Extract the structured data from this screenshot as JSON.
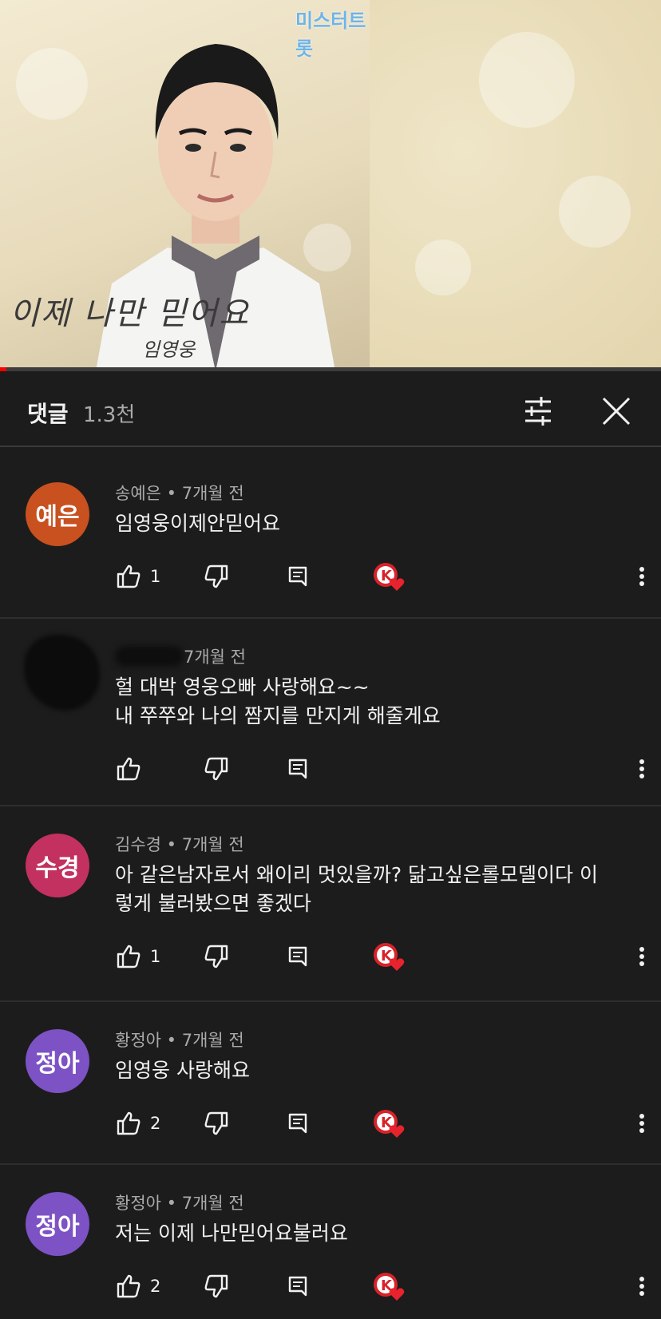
{
  "video": {
    "song_title": "이제 나만 믿어요",
    "artist": "임영웅",
    "logo_text": "미스터트롯"
  },
  "header": {
    "title": "댓글",
    "count": "1.3천"
  },
  "icons": {
    "filter": "sliders-icon",
    "close": "close-icon",
    "like": "thumb-up-icon",
    "dislike": "thumb-down-icon",
    "reply": "reply-icon",
    "creator_heart": "creator-heart-badge-icon",
    "more": "more-vert-icon"
  },
  "colors": {
    "background": "#1c1c1c",
    "avatar_1": "#c9501f",
    "avatar_2": "#c2315f",
    "avatar_3": "#7d52c4",
    "heart": "#e8232e"
  },
  "comments": [
    {
      "avatar_text": "예은",
      "author": "송예은",
      "time": "7개월 전",
      "lines": [
        "임영웅이제안믿어요"
      ],
      "likes": "1",
      "hearted": true
    },
    {
      "avatar_text": "",
      "author": "",
      "time": "7개월 전",
      "lines": [
        "헐 대박 영웅오빠 사랑해요~~",
        "내 쭈쭈와 나의 짬지를 만지게 해줄게요"
      ],
      "likes": "",
      "hearted": false
    },
    {
      "avatar_text": "수경",
      "author": "김수경",
      "time": "7개월 전",
      "lines": [
        "아 같은남자로서 왜이리 멋있을까? 닮고싶은롤모델이다 이",
        "렇게 불러봤으면 좋겠다"
      ],
      "likes": "1",
      "hearted": true
    },
    {
      "avatar_text": "정아",
      "author": "황정아",
      "time": "7개월 전",
      "lines": [
        "임영웅 사랑해요"
      ],
      "likes": "2",
      "hearted": true
    },
    {
      "avatar_text": "정아",
      "author": "황정아",
      "time": "7개월 전",
      "lines": [
        "저는 이제 나만믿어요불러요"
      ],
      "likes": "2",
      "hearted": true
    }
  ]
}
